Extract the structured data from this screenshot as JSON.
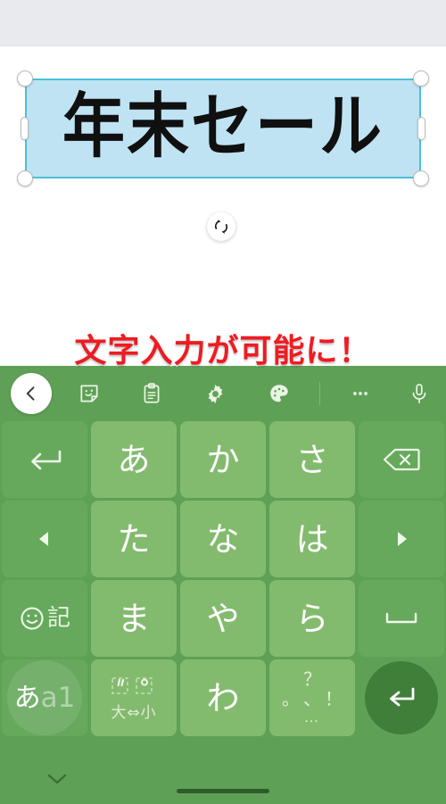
{
  "app": {
    "status_bar": {
      "content": ""
    }
  },
  "canvas": {
    "text_box": {
      "text": "年末セール",
      "fill_color": "#bfe3f3",
      "border_color": "#49c1da",
      "text_color": "#101010",
      "handles": [
        "top-left",
        "top-right",
        "bottom-left",
        "bottom-right",
        "middle-left",
        "middle-right"
      ],
      "rotate_handle_icon": "rotate-icon"
    }
  },
  "caption": {
    "text": "文字入力が可能に！",
    "color": "#ee1c22",
    "outline_color": "#ffffff"
  },
  "keyboard": {
    "background_color": "#5fa057",
    "key_color": "#83bb6e",
    "side_key_color": "#66a95c",
    "enter_key_color": "#3f7f39",
    "toolbar": {
      "back_label": "back-chevron",
      "items": [
        {
          "name": "sticker-icon",
          "label": "sticker"
        },
        {
          "name": "clipboard-icon",
          "label": "clipboard"
        },
        {
          "name": "gear-icon",
          "label": "settings"
        },
        {
          "name": "palette-icon",
          "label": "theme"
        },
        {
          "name": "more-icon",
          "label": "…"
        },
        {
          "name": "microphone-icon",
          "label": "voice"
        }
      ]
    },
    "rows": [
      {
        "left": {
          "name": "undo-key",
          "label": "↶",
          "icon": "undo-arrow-icon"
        },
        "keys": [
          {
            "name": "key-a",
            "label": "あ"
          },
          {
            "name": "key-ka",
            "label": "か"
          },
          {
            "name": "key-sa",
            "label": "さ"
          }
        ],
        "right": {
          "name": "backspace-key",
          "label": "⌫",
          "icon": "backspace-icon"
        }
      },
      {
        "left": {
          "name": "cursor-left-key",
          "label": "◀",
          "icon": "caret-left-icon"
        },
        "keys": [
          {
            "name": "key-ta",
            "label": "た"
          },
          {
            "name": "key-na",
            "label": "な"
          },
          {
            "name": "key-ha",
            "label": "は"
          }
        ],
        "right": {
          "name": "cursor-right-key",
          "label": "▶",
          "icon": "caret-right-icon"
        }
      },
      {
        "left": {
          "name": "emoji-symbol-key",
          "label": "記",
          "icon": "smiley-icon"
        },
        "keys": [
          {
            "name": "key-ma",
            "label": "ま"
          },
          {
            "name": "key-ya",
            "label": "や"
          },
          {
            "name": "key-ra",
            "label": "ら"
          }
        ],
        "right": {
          "name": "space-key",
          "label": "␣",
          "icon": "space-icon"
        }
      },
      {
        "left": {
          "name": "input-mode-key",
          "label_main": "あ",
          "label_sub": "a1"
        },
        "keys": [
          {
            "name": "dakuten-key",
            "label": "゛ ゜",
            "sub": "大⇔小"
          },
          {
            "name": "key-wa",
            "label": "わ"
          },
          {
            "name": "punctuation-key",
            "top": "？",
            "mid_left": "。",
            "mid_right": "、",
            "mid_end": "！",
            "bottom": "…"
          }
        ],
        "right": {
          "name": "enter-key",
          "label": "↵",
          "icon": "enter-icon"
        }
      }
    ]
  },
  "nav_bar": {
    "hide_keyboard_icon": "chevron-down-icon",
    "home_indicator": ""
  }
}
